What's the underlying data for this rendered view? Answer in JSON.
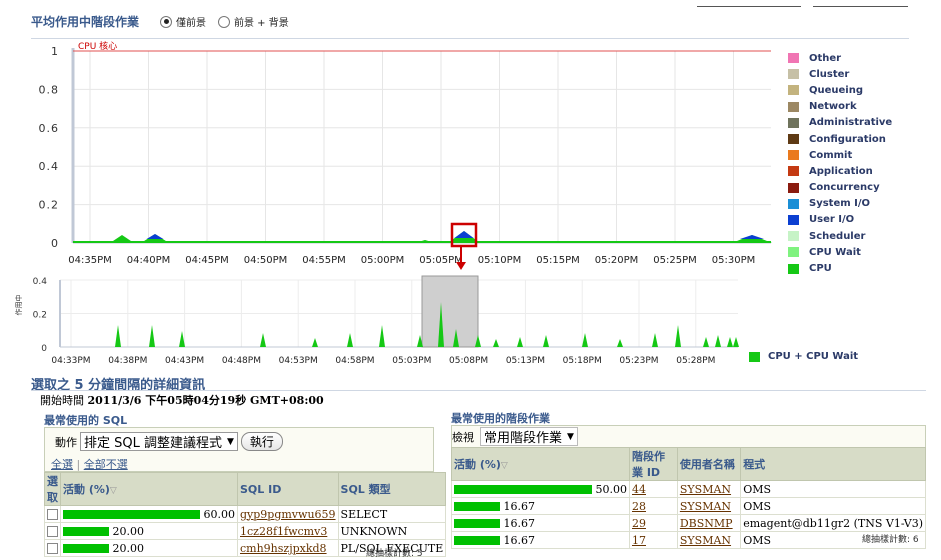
{
  "header": {
    "title": "平均作用中階段作業",
    "radio_options": [
      {
        "label": "僅前景",
        "selected": true
      },
      {
        "label": "前景 + 背景",
        "selected": false
      }
    ]
  },
  "main_chart": {
    "cpu_core_label": "CPU 核心",
    "y_ticks": [
      "1",
      "0.8",
      "0.6",
      "0.4",
      "0.2",
      "0"
    ],
    "x_ticks": [
      "04:35PM",
      "04:40PM",
      "04:45PM",
      "04:50PM",
      "04:55PM",
      "05:00PM",
      "05:05PM",
      "05:10PM",
      "05:15PM",
      "05:20PM",
      "05:25PM",
      "05:30PM"
    ],
    "highlight_color": "#cc0000"
  },
  "legend": [
    {
      "label": "Other",
      "color": "#f075b3"
    },
    {
      "label": "Cluster",
      "color": "#c6c0a6"
    },
    {
      "label": "Queueing",
      "color": "#c3b37e"
    },
    {
      "label": "Network",
      "color": "#9c8863"
    },
    {
      "label": "Administrative",
      "color": "#6f735c"
    },
    {
      "label": "Configuration",
      "color": "#5e3a14"
    },
    {
      "label": "Commit",
      "color": "#ea7a1e"
    },
    {
      "label": "Application",
      "color": "#c43a12"
    },
    {
      "label": "Concurrency",
      "color": "#8a1b0f"
    },
    {
      "label": "System I/O",
      "color": "#1a8fd6"
    },
    {
      "label": "User I/O",
      "color": "#0b3fd1"
    },
    {
      "label": "Scheduler",
      "color": "#c6f3c6"
    },
    {
      "label": "CPU Wait",
      "color": "#7ff27f"
    },
    {
      "label": "CPU",
      "color": "#15c815"
    }
  ],
  "overview_chart": {
    "y_axis_label": "作用中",
    "y_ticks": [
      "0.4",
      "0.2",
      "0"
    ],
    "x_ticks": [
      "04:33PM",
      "04:38PM",
      "04:43PM",
      "04:48PM",
      "04:53PM",
      "04:58PM",
      "05:03PM",
      "05:08PM",
      "05:13PM",
      "05:18PM",
      "05:23PM",
      "05:28PM"
    ],
    "legend_label": "CPU + CPU Wait",
    "legend_color": "#15c815"
  },
  "details": {
    "title": "選取之 5 分鐘間隔的詳細資訊",
    "start_label": "開始時間",
    "start_value": "2011/3/6 下午05時04分19秒 GMT+08:00"
  },
  "top_sql": {
    "title": "最常使用的 SQL",
    "action_label": "動作",
    "action_value": "排定 SQL 調整建議程式",
    "execute_label": "執行",
    "select_all": "全選",
    "select_none": "全部不選",
    "columns": [
      "選取",
      "活動 (%)",
      "SQL ID",
      "SQL 類型"
    ],
    "rows": [
      {
        "activity": "60.00",
        "pct": 0.6,
        "sql_id": "gyp9pgmvwu659",
        "sql_type": "SELECT"
      },
      {
        "activity": "20.00",
        "pct": 0.2,
        "sql_id": "1cz28f1fwcmv3",
        "sql_type": "UNKNOWN"
      },
      {
        "activity": "20.00",
        "pct": 0.2,
        "sql_id": "cmh9hszjpxkd8",
        "sql_type": "PL/SQL EXECUTE"
      }
    ],
    "footer": "總抽樣計數: 5"
  },
  "top_sessions": {
    "title": "最常使用的階段作業",
    "view_label": "檢視",
    "view_value": "常用階段作業",
    "columns": [
      "活動 (%)",
      "階段作業 ID",
      "使用者名稱",
      "程式"
    ],
    "rows": [
      {
        "activity": "50.00",
        "pct": 0.5,
        "sid": "44",
        "user": "SYSMAN",
        "program": "OMS"
      },
      {
        "activity": "16.67",
        "pct": 0.1667,
        "sid": "28",
        "user": "SYSMAN",
        "program": "OMS"
      },
      {
        "activity": "16.67",
        "pct": 0.1667,
        "sid": "29",
        "user": "DBSNMP",
        "program": "emagent@db11gr2 (TNS V1-V3)"
      },
      {
        "activity": "16.67",
        "pct": 0.1667,
        "sid": "17",
        "user": "SYSMAN",
        "program": "OMS"
      }
    ],
    "footer": "總抽樣計數: 6"
  }
}
